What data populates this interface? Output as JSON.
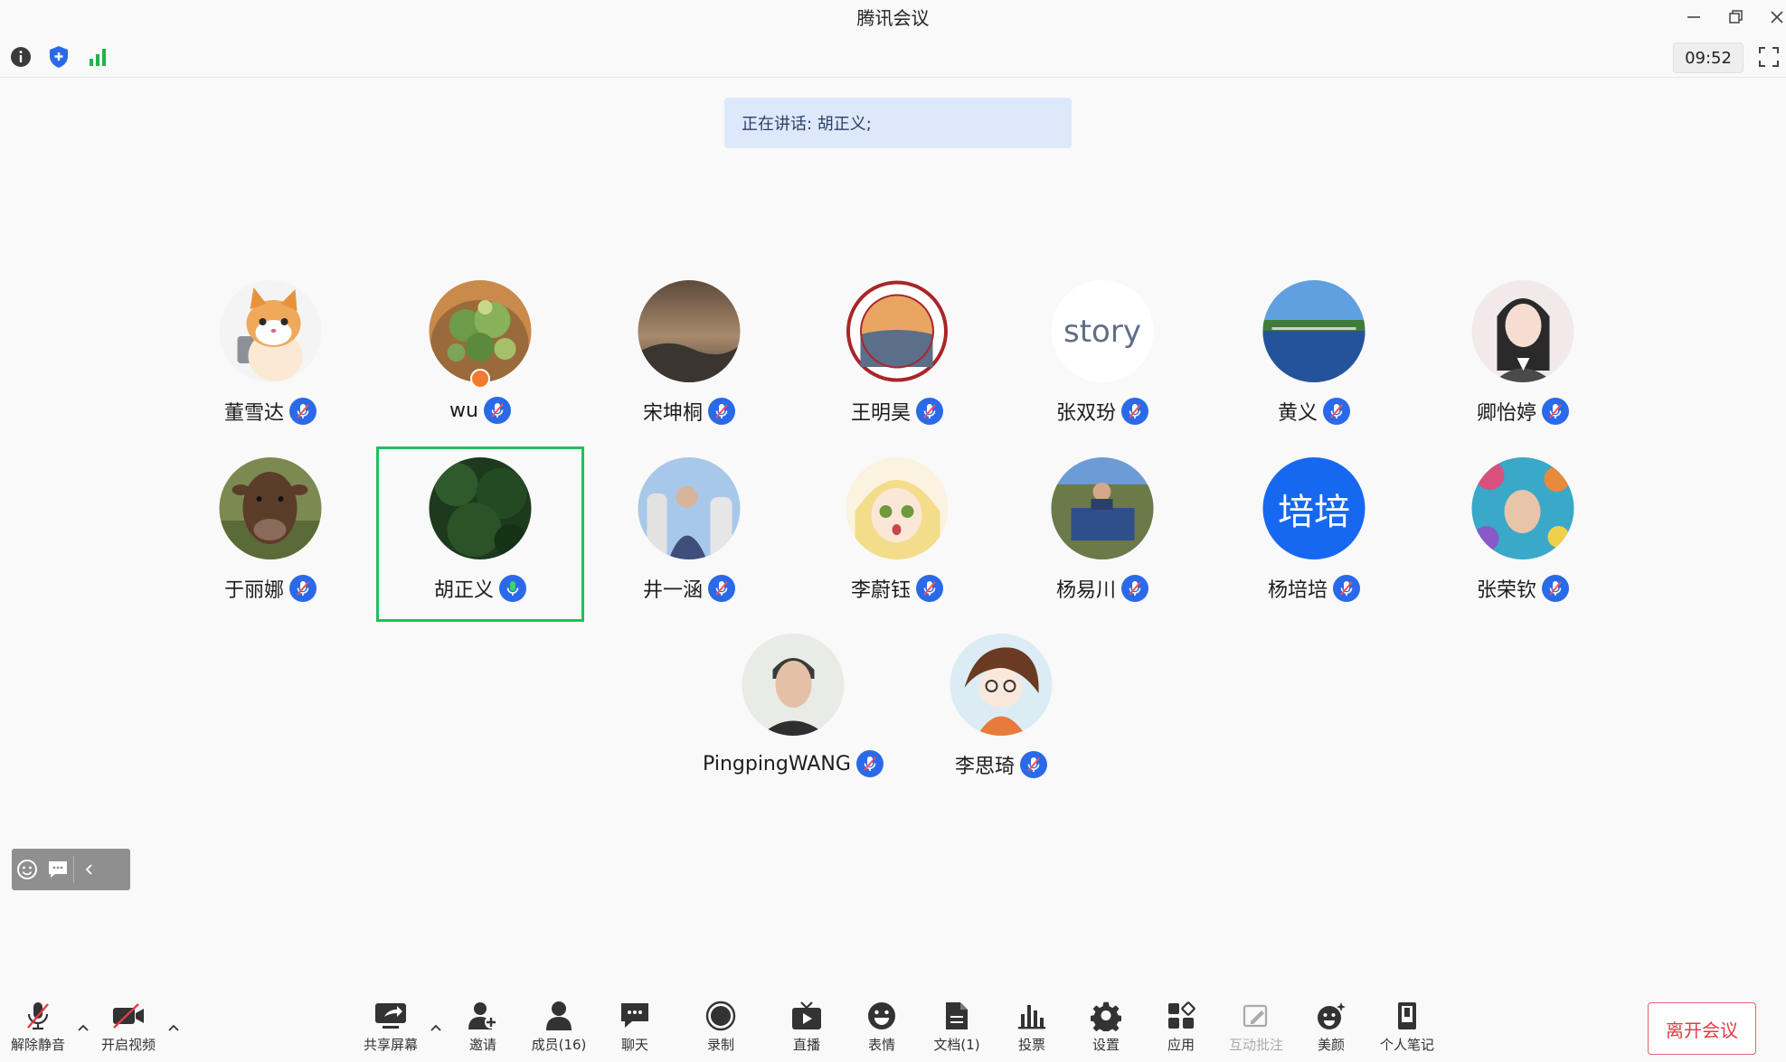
{
  "window": {
    "title": "腾讯会议"
  },
  "infobar": {
    "timer": "09:52"
  },
  "speaking": {
    "text": "正在讲话: 胡正义;"
  },
  "participants": [
    {
      "name": "董雪达"
    },
    {
      "name": "wu"
    },
    {
      "name": "宋坤桐"
    },
    {
      "name": "王明昊"
    },
    {
      "name": "张双玢",
      "avatar_text": "story"
    },
    {
      "name": "黄义"
    },
    {
      "name": "卿怡婷"
    },
    {
      "name": "于丽娜"
    },
    {
      "name": "胡正义"
    },
    {
      "name": "井一涵"
    },
    {
      "name": "李蔚钰"
    },
    {
      "name": "杨易川"
    },
    {
      "name": "杨培培",
      "avatar_text": "培培"
    },
    {
      "name": "张荣钦"
    },
    {
      "name": "PingpingWANG"
    },
    {
      "name": "李思琦"
    }
  ],
  "toolbar": {
    "unmute": "解除静音",
    "video": "开启视频",
    "share": "共享屏幕",
    "invite": "邀请",
    "members": "成员(16)",
    "chat": "聊天",
    "record": "录制",
    "live": "直播",
    "emoji": "表情",
    "docs": "文档(1)",
    "vote": "投票",
    "settings": "设置",
    "apps": "应用",
    "annotate": "互动批注",
    "beauty": "美颜",
    "notes": "个人笔记",
    "leave": "离开会议"
  },
  "colors": {
    "accent_blue": "#2a6ae8",
    "active_speaker_border": "#21c05a",
    "leave_red": "#e23b45",
    "speaking_banner_bg": "#dde9fb"
  }
}
